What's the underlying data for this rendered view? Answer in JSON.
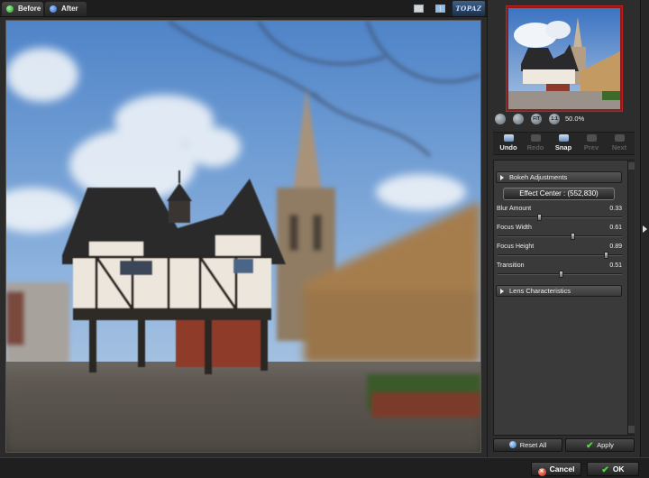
{
  "tabs": [
    {
      "label": "Before",
      "icon": "green-dot-icon"
    },
    {
      "label": "After",
      "icon": "blue-dot-icon"
    }
  ],
  "view_icons": [
    "single-view-icon",
    "split-view-icon"
  ],
  "logo": {
    "text": "TOPAZ"
  },
  "navigator": {
    "zoom_buttons": [
      "zoom-out-icon",
      "zoom-in-icon",
      "fit-icon",
      "one-to-one-icon"
    ],
    "zoom_labels": [
      "",
      "",
      "FIT",
      "1:1"
    ],
    "zoom_value": "50.0%"
  },
  "history": {
    "undo": "Undo",
    "redo": "Redo",
    "snap": "Snap",
    "prev": "Prev",
    "next": "Next"
  },
  "bokeh": {
    "section_label": "Bokeh Adjustments",
    "effect_center_label": "Effect Center : (552,830)",
    "params": [
      {
        "label": "Blur Amount",
        "value": "0.33",
        "fraction": 0.33
      },
      {
        "label": "Focus Width",
        "value": "0.61",
        "fraction": 0.61
      },
      {
        "label": "Focus Height",
        "value": "0.89",
        "fraction": 0.89
      },
      {
        "label": "Transition",
        "value": "0.51",
        "fraction": 0.51
      }
    ]
  },
  "lens": {
    "section_label": "Lens Characteristics"
  },
  "panel_buttons": {
    "reset_all": "Reset All",
    "apply": "Apply"
  },
  "footer": {
    "cancel": "Cancel",
    "ok": "OK"
  },
  "colors": {
    "accent_green": "#5bd44a",
    "preview_border": "#c02222"
  }
}
